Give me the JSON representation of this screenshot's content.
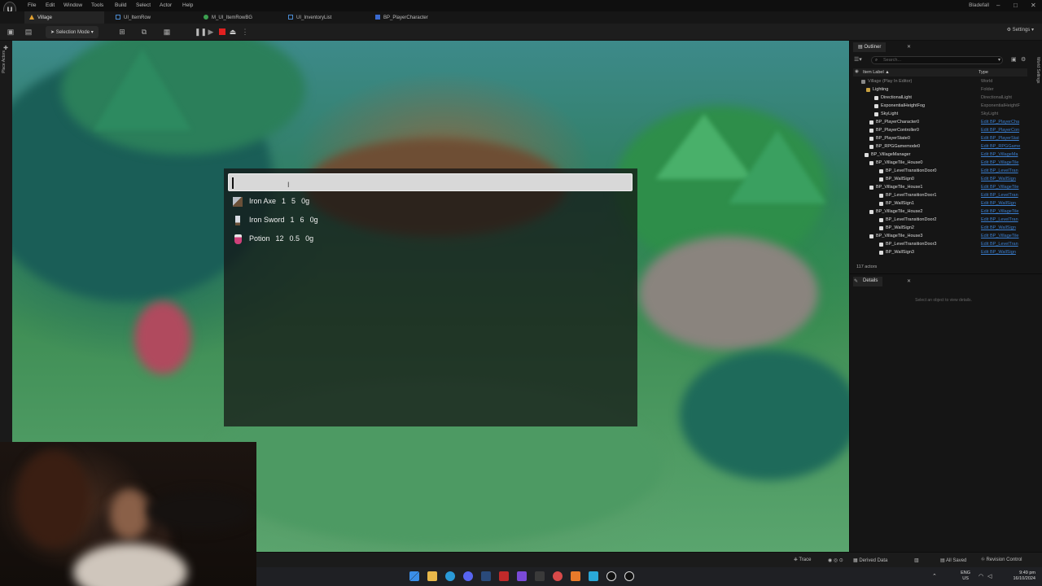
{
  "menubar": {
    "logo": "U",
    "items": [
      "File",
      "Edit",
      "Window",
      "Tools",
      "Build",
      "Select",
      "Actor",
      "Help"
    ],
    "project_name": "Bladefall"
  },
  "tabs": [
    {
      "label": "Village",
      "active": true
    },
    {
      "label": "UI_ItemRow",
      "active": false
    },
    {
      "label": "M_UI_ItemRowBG",
      "active": false
    },
    {
      "label": "UI_InventoryList",
      "active": false
    },
    {
      "label": "BP_PlayerCharacter",
      "active": false
    }
  ],
  "toolbar": {
    "selection_mode": "Selection Mode",
    "settings": "Settings"
  },
  "left_strip": {
    "place_actors": "Place Actors"
  },
  "inventory": {
    "search_value": "",
    "items": [
      {
        "name": "Iron Axe",
        "qty": "1",
        "weight": "5",
        "value": "0g",
        "icon_color": "#9aa0a8",
        "icon": "axe-icon"
      },
      {
        "name": "Iron Sword",
        "qty": "1",
        "weight": "6",
        "value": "0g",
        "icon_color": "#c8c8d0",
        "icon": "sword-icon"
      },
      {
        "name": "Potion",
        "qty": "12",
        "weight": "0.5",
        "value": "0g",
        "icon_color": "#d0407a",
        "icon": "potion-icon"
      }
    ]
  },
  "outliner": {
    "tab_label": "Outliner",
    "search_placeholder": "Search...",
    "col_label": "Item Label ▲",
    "col_type": "Type",
    "rows": [
      {
        "label": "Village (Play In Editor)",
        "type": "World",
        "link": false,
        "dim": true
      },
      {
        "label": "Lighting",
        "type": "Folder",
        "link": false,
        "dim": false
      },
      {
        "label": "DirectionalLight",
        "type": "DirectionalLight",
        "link": false,
        "dim": false
      },
      {
        "label": "ExponentialHeightFog",
        "type": "ExponentialHeightF",
        "link": false,
        "dim": false
      },
      {
        "label": "SkyLight",
        "type": "SkyLight",
        "link": false,
        "dim": false
      },
      {
        "label": "BP_PlayerCharacter0",
        "type": "Edit BP_PlayerCha",
        "link": true,
        "dim": false
      },
      {
        "label": "BP_PlayerController0",
        "type": "Edit BP_PlayerCon",
        "link": true,
        "dim": false
      },
      {
        "label": "BP_PlayerState0",
        "type": "Edit BP_PlayerStat",
        "link": true,
        "dim": false
      },
      {
        "label": "BP_RPGGamemode0",
        "type": "Edit BP_RPGGame",
        "link": true,
        "dim": false
      },
      {
        "label": "BP_VillageManager",
        "type": "Edit BP_VillageMa",
        "link": true,
        "dim": false
      },
      {
        "label": "BP_VillageTile_House0",
        "type": "Edit BP_VillageTile",
        "link": true,
        "dim": false
      },
      {
        "label": "BP_LevelTransitionDoor0",
        "type": "Edit BP_LevelTran",
        "link": true,
        "dim": false
      },
      {
        "label": "BP_WallSign0",
        "type": "Edit BP_WallSign",
        "link": true,
        "dim": false
      },
      {
        "label": "BP_VillageTile_House1",
        "type": "Edit BP_VillageTile",
        "link": true,
        "dim": false
      },
      {
        "label": "BP_LevelTransitionDoor1",
        "type": "Edit BP_LevelTran",
        "link": true,
        "dim": false
      },
      {
        "label": "BP_WallSign1",
        "type": "Edit BP_WallSign",
        "link": true,
        "dim": false
      },
      {
        "label": "BP_VillageTile_House2",
        "type": "Edit BP_VillageTile",
        "link": true,
        "dim": false
      },
      {
        "label": "BP_LevelTransitionDoor2",
        "type": "Edit BP_LevelTran",
        "link": true,
        "dim": false
      },
      {
        "label": "BP_WallSign2",
        "type": "Edit BP_WallSign",
        "link": true,
        "dim": false
      },
      {
        "label": "BP_VillageTile_House3",
        "type": "Edit BP_VillageTile",
        "link": true,
        "dim": false
      },
      {
        "label": "BP_LevelTransitionDoor3",
        "type": "Edit BP_LevelTran",
        "link": true,
        "dim": false
      },
      {
        "label": "BP_WallSign3",
        "type": "Edit BP_WallSign",
        "link": true,
        "dim": false
      }
    ],
    "actor_count": "117 actors",
    "world_settings": "World Settings"
  },
  "details": {
    "tab_label": "Details",
    "empty_text": "Select an object to view details."
  },
  "statusbar": {
    "trace": "Trace",
    "derived_data": "Derived Data",
    "all_saved": "All Saved",
    "revision_control": "Revision Control"
  },
  "taskbar": {
    "lang_top": "ENG",
    "lang_bottom": "US",
    "time": "9:49 pm",
    "date": "16/10/2024"
  }
}
